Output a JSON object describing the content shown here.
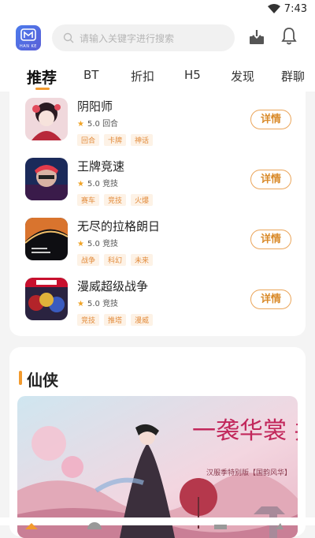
{
  "status_bar": {
    "time": "7:43",
    "wifi_icon": "wifi-icon"
  },
  "header": {
    "logo_text": "HAN KE",
    "search_placeholder": "请输入关键字进行搜索",
    "download_icon": "download-icon",
    "bell_icon": "bell-icon"
  },
  "tabs": [
    {
      "label": "推荐",
      "active": true
    },
    {
      "label": "BT"
    },
    {
      "label": "折扣"
    },
    {
      "label": "H5"
    },
    {
      "label": "发现"
    },
    {
      "label": "群聊"
    }
  ],
  "games": [
    {
      "name": "阴阳师",
      "rating": "5.0",
      "genre": "回合",
      "tags": [
        "回合",
        "卡牌",
        "神话"
      ],
      "button": "详情"
    },
    {
      "name": "王牌竞速",
      "rating": "5.0",
      "genre": "竞技",
      "tags": [
        "赛车",
        "竞技",
        "火爆"
      ],
      "button": "详情"
    },
    {
      "name": "无尽的拉格朗日",
      "rating": "5.0",
      "genre": "竞技",
      "tags": [
        "战争",
        "科幻",
        "未来"
      ],
      "button": "详情"
    },
    {
      "name": "漫威超级战争",
      "rating": "5.0",
      "genre": "竞技",
      "tags": [
        "竞技",
        "推塔",
        "漫威"
      ],
      "button": "详情"
    }
  ],
  "section": {
    "title": "仙侠",
    "banner": {
      "headline": "一袭华裳 共赴天",
      "subline": "汉服季特别版【国韵风华】"
    }
  },
  "colors": {
    "accent": "#f29a2e",
    "tag_bg": "#fdf2e6",
    "tag_text": "#e28b3b"
  }
}
